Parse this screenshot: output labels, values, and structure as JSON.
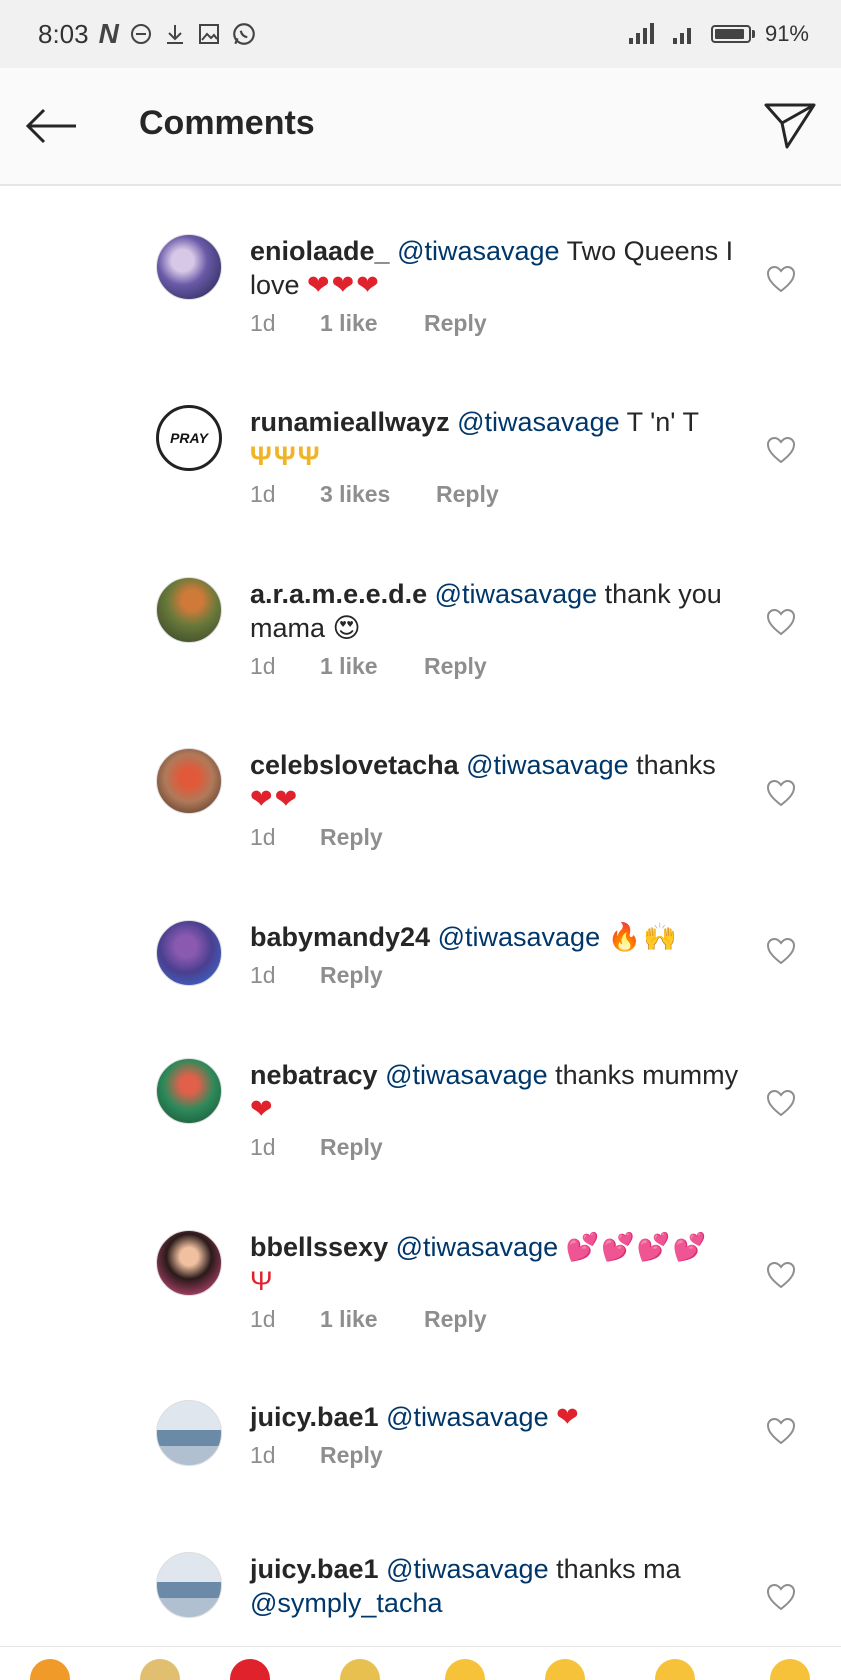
{
  "status_bar": {
    "time": "8:03",
    "battery_text": "91%",
    "battery_level": 0.91,
    "left_icons": [
      "n-app-icon",
      "minus-circle-icon",
      "download-icon",
      "image-icon",
      "whatsapp-icon"
    ],
    "right_icons": [
      "signal-icon",
      "signal-icon-2",
      "battery-icon"
    ]
  },
  "header": {
    "title": "Comments",
    "back_icon": "arrow-left-icon",
    "send_icon": "send-icon"
  },
  "colors": {
    "mention": "#00376b",
    "meta": "#8e8e8e",
    "heart": "#ed4956",
    "trident": "#f0b429"
  },
  "comments": [
    {
      "username": "eniolaade_",
      "mention": "@tiwasavage",
      "text": "Two Queens I love",
      "emoji": "❤❤❤",
      "time": "1d",
      "likes": "1 like",
      "reply": "Reply",
      "avatar_color": "#6a5aa8"
    },
    {
      "username": "runamieallwayz",
      "mention": "@tiwasavage",
      "text": "T 'n' T",
      "emoji": "ΨΨΨ",
      "time": "1d",
      "likes": "3 likes",
      "reply": "Reply",
      "avatar_text": "PRAY"
    },
    {
      "username": "a.r.a.m.e.e.d.e",
      "mention": "@tiwasavage",
      "text": "thank you mama",
      "emoji": "😍",
      "time": "1d",
      "likes": "1 like",
      "reply": "Reply",
      "avatar_color": "#7a6b3a"
    },
    {
      "username": "celebslovetacha",
      "mention": "@tiwasavage",
      "text": "thanks",
      "emoji": "❤❤",
      "time": "1d",
      "likes": "",
      "reply": "Reply",
      "avatar_color": "#c45a4a"
    },
    {
      "username": "babymandy24",
      "mention": "@tiwasavage",
      "text": "",
      "emoji": "🔥🙌",
      "time": "1d",
      "likes": "",
      "reply": "Reply",
      "avatar_color": "#4a3f8f"
    },
    {
      "username": "nebatracy",
      "mention": "@tiwasavage",
      "text": "thanks mummy",
      "emoji": "❤",
      "time": "1d",
      "likes": "",
      "reply": "Reply",
      "avatar_color": "#2e8a5a"
    },
    {
      "username": "bbellssexy",
      "mention": "@tiwasavage",
      "text": "",
      "emoji": "💕💕💕💕 Ψ",
      "time": "1d",
      "likes": "1 like",
      "reply": "Reply",
      "avatar_color": "#c84a7a"
    },
    {
      "username": "juicy.bae1",
      "mention": "@tiwasavage",
      "text": "",
      "emoji": "❤",
      "time": "1d",
      "likes": "",
      "reply": "Reply",
      "avatar_color": "#8aa4c2"
    },
    {
      "username": "juicy.bae1",
      "mention": "@tiwasavage",
      "text": "thanks ma",
      "mention2": "@symply_tacha",
      "emoji": "",
      "time": "",
      "likes": "",
      "reply": "",
      "avatar_color": "#8aa4c2"
    }
  ]
}
